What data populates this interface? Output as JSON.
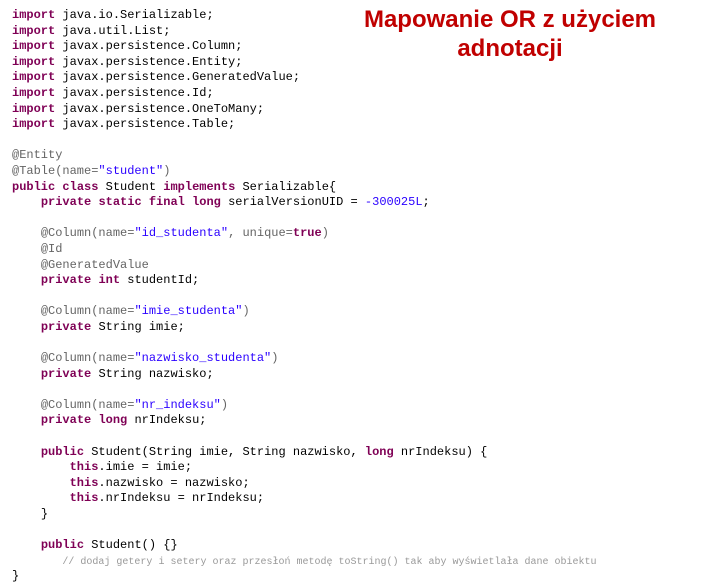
{
  "title": "Mapowanie OR z użyciem adnotacji",
  "code": {
    "imp": "import",
    "i1": "java.io.Serializable;",
    "i2": "java.util.List;",
    "i3": "javax.persistence.Column;",
    "i4": "javax.persistence.Entity;",
    "i5": "javax.persistence.GeneratedValue;",
    "i6": "javax.persistence.Id;",
    "i7": "javax.persistence.OneToMany;",
    "i8": "javax.persistence.Table;",
    "a_entity": "@Entity",
    "a_table_pre": "@Table(name=",
    "a_table_val": "\"student\"",
    "a_table_post": ")",
    "kw_public": "public",
    "kw_class": "class",
    "cls_name": "Student",
    "kw_implements": "implements",
    "iface": "Serializable{",
    "kw_private": "private",
    "kw_static": "static",
    "kw_final": "final",
    "kw_long": "long",
    "svuid": "serialVersionUID = ",
    "svuid_val": "-300025L",
    "semi": ";",
    "a_col_pre": "@Column(name=",
    "a_col1_val": "\"id_studenta\"",
    "a_col1_uni": ", unique=",
    "kw_true": "true",
    "a_close": ")",
    "a_id": "@Id",
    "a_gen": "@GeneratedValue",
    "kw_int": "int",
    "f1": "studentId;",
    "a_col2_val": "\"imie_studenta\"",
    "type_string": "String imie;",
    "a_col3_val": "\"nazwisko_studenta\"",
    "f3": "String nazwisko;",
    "a_col4_val": "\"nr_indeksu\"",
    "f4": "nrIndeksu;",
    "ctor_sig": "Student(String imie, String nazwisko, ",
    "ctor_sig2": " nrIndeksu) {",
    "kw_this": "this",
    "as1": ".imie = imie;",
    "as2": ".nazwisko = nazwisko;",
    "as3": ".nrIndeksu = nrIndeksu;",
    "brace_close": "}",
    "ctor2": "Student() {}",
    "comment": "// dodaj getery i setery oraz przesłoń metodę toString() tak aby wyświetlała dane obiektu"
  }
}
